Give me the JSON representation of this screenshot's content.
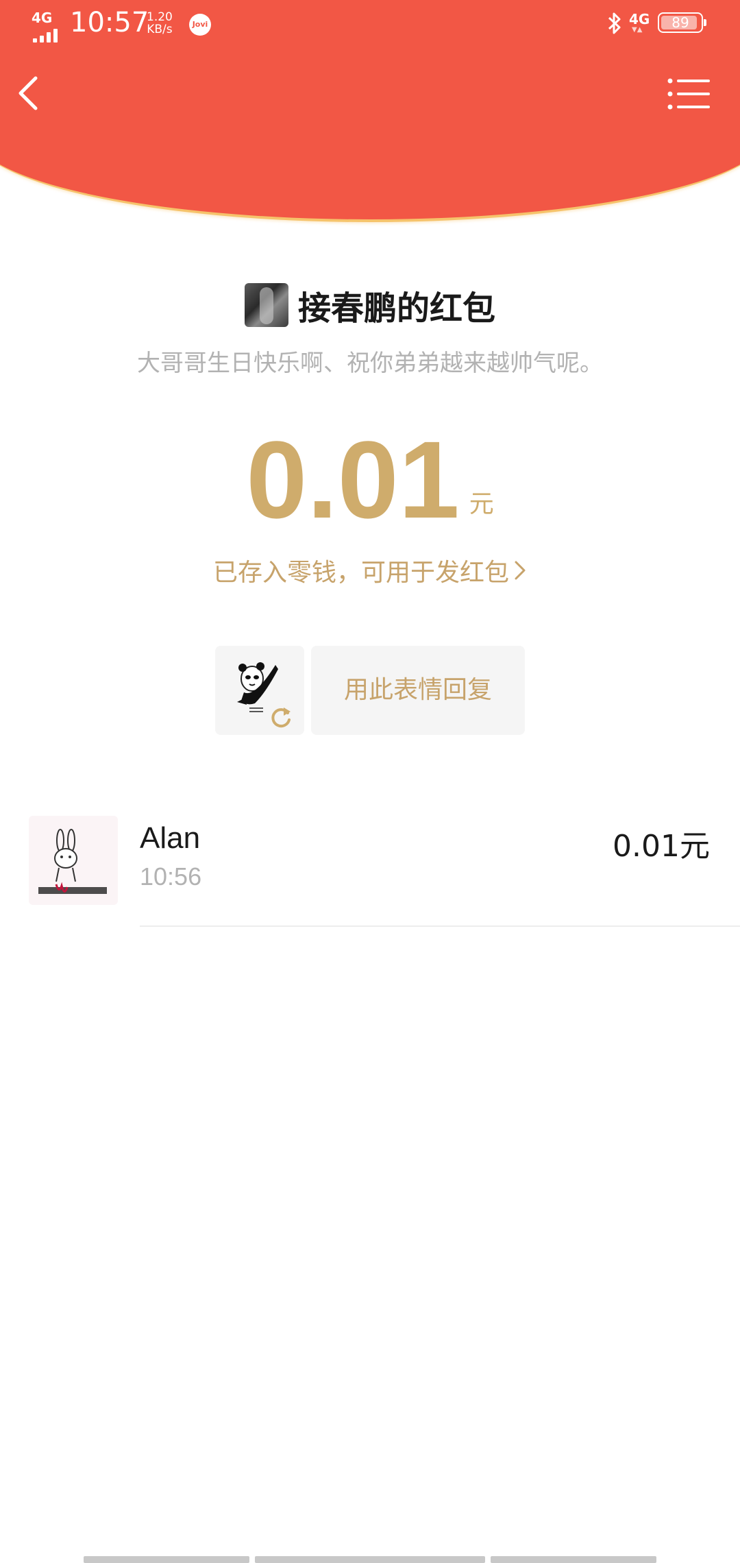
{
  "status_bar": {
    "network_left": "4G",
    "time": "10:57",
    "speed_value": "1.20",
    "speed_unit": "KB/s",
    "jovi": "Jovi",
    "network_right": "4G",
    "battery": "89"
  },
  "nav": {
    "back_icon": "chevron-left-icon",
    "menu_icon": "list-icon"
  },
  "packet": {
    "title": "接春鹏的红包",
    "blessing": "大哥哥生日快乐啊、祝你弟弟越来越帅气呢。",
    "amount": "0.01",
    "unit": "元",
    "stored_text": "已存入零钱，可用于发红包"
  },
  "reply": {
    "label": "用此表情回复"
  },
  "receivers": [
    {
      "name": "Alan",
      "time": "10:56",
      "amount": "0.01元"
    }
  ],
  "colors": {
    "header": "#F25745",
    "header_border": "#F6C36B",
    "gold": "#CFAC6C"
  }
}
